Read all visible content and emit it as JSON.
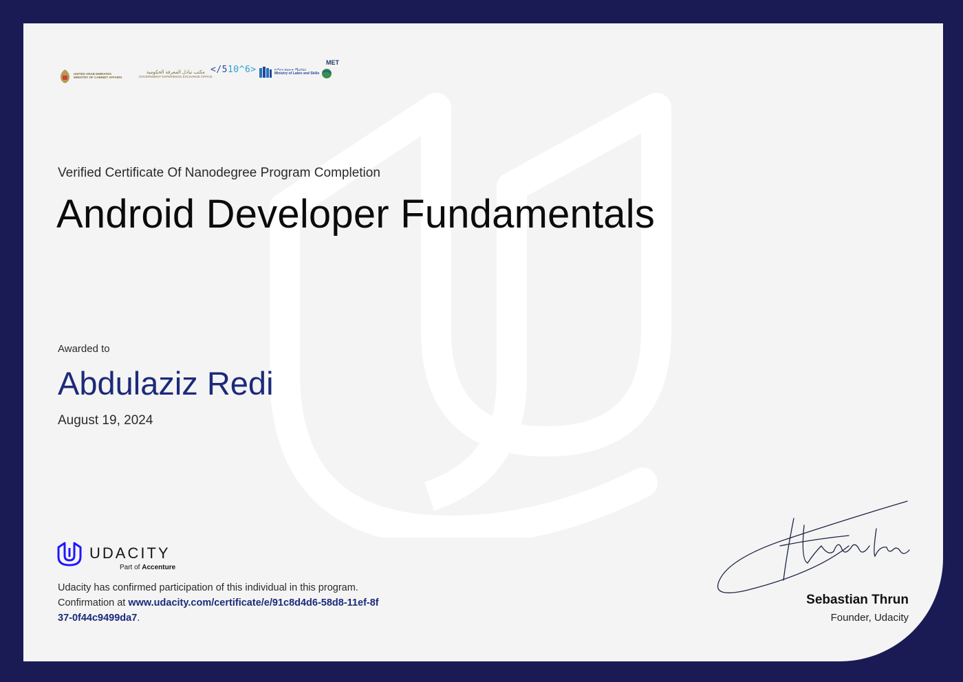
{
  "certificate": {
    "subtitle": "Verified Certificate Of Nanodegree Program Completion",
    "program_title": "Android Developer Fundamentals",
    "awarded_label": "Awarded to",
    "recipient": "Abdulaziz Redi",
    "date": "August 19, 2024"
  },
  "partner_logos": {
    "uae": {
      "line1": "UNITED ARAB EMIRATES",
      "line2": "MINISTRY OF CABINET AFFAIRS"
    },
    "gov_exchange": {
      "arabic": "مكتب تبادل المعرفة الحكومية",
      "english": "GOVERNMENT EXPERIENCE EXCHANGE OFFICE"
    },
    "coders": {
      "code_open": "</5",
      "code_close": "10^6>"
    },
    "labor": {
      "line1": "የሥራና ክህሎት ሚኒስቴር",
      "line2": "Ministry of Labor and Skills"
    },
    "met": {
      "label": "MET"
    }
  },
  "brand": {
    "wordmark": "UDACITY",
    "part_of_prefix": "Part of",
    "part_of_company": "Accenture",
    "accent_color": "#2015ff"
  },
  "confirmation": {
    "text": "Udacity has confirmed participation of this individual in this program. Confirmation at",
    "link": "www.udacity.com/certificate/e/91c8d4d6-58d8-11ef-8f37-0f44c9499da7",
    "suffix": "."
  },
  "signatory": {
    "name": "Sebastian Thrun",
    "title": "Founder, Udacity"
  },
  "colors": {
    "frame": "#1a1b55",
    "paper": "#f4f4f4",
    "recipient": "#1c2a7a"
  }
}
